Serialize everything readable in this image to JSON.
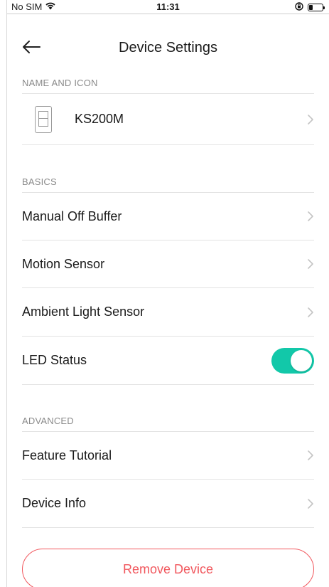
{
  "status_bar": {
    "carrier": "No SIM",
    "time": "11:31",
    "battery_level": 0.25,
    "icons": [
      "wifi-icon",
      "orientation-lock-icon",
      "battery-icon"
    ]
  },
  "nav": {
    "back_icon": "back-arrow-icon",
    "title": "Device Settings"
  },
  "sections": {
    "name_and_icon": {
      "header": "NAME AND ICON",
      "device_name": "KS200M",
      "device_icon": "light-switch-icon"
    },
    "basics": {
      "header": "BASICS",
      "items": [
        {
          "label": "Manual Off Buffer",
          "kind": "link"
        },
        {
          "label": "Motion Sensor",
          "kind": "link"
        },
        {
          "label": "Ambient Light Sensor",
          "kind": "link"
        },
        {
          "label": "LED Status",
          "kind": "toggle",
          "on": true
        }
      ]
    },
    "advanced": {
      "header": "ADVANCED",
      "items": [
        {
          "label": "Feature Tutorial",
          "kind": "link"
        },
        {
          "label": "Device Info",
          "kind": "link"
        }
      ]
    }
  },
  "remove_button": {
    "label": "Remove Device"
  },
  "colors": {
    "accent_toggle": "#12c8a9",
    "danger": "#f1585e",
    "section_header": "#8a8a8a",
    "divider": "#e3e3e3",
    "chevron": "#c4c4c4"
  }
}
